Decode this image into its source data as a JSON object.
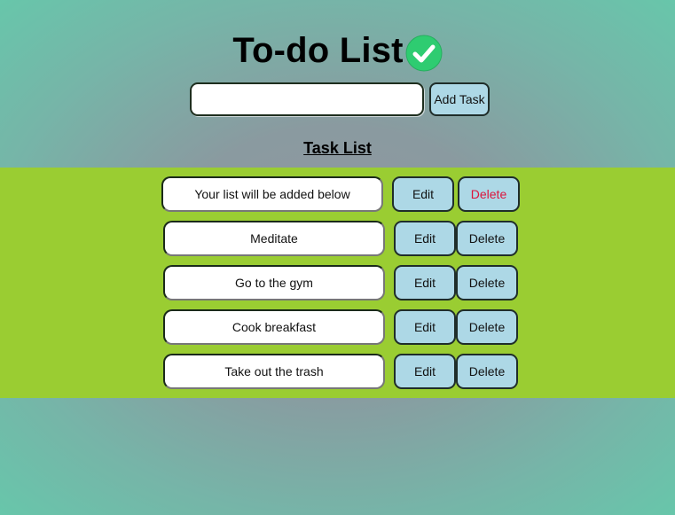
{
  "header": {
    "title": "To-do List"
  },
  "add_form": {
    "input_value": "",
    "input_placeholder": "",
    "add_label": "Add Task"
  },
  "section": {
    "title": "Task List"
  },
  "tasks": [
    {
      "text": "Your list will be added below",
      "edit_label": "Edit",
      "delete_label": "Delete"
    },
    {
      "text": "Meditate",
      "edit_label": "Edit",
      "delete_label": "Delete"
    },
    {
      "text": "Go to the gym",
      "edit_label": "Edit",
      "delete_label": "Delete"
    },
    {
      "text": "Cook breakfast",
      "edit_label": "Edit",
      "delete_label": "Delete"
    },
    {
      "text": "Take out the trash",
      "edit_label": "Edit",
      "delete_label": "Delete"
    }
  ],
  "icons": {
    "title_icon": "check-circle-icon"
  },
  "colors": {
    "task_band": "#9acd32",
    "button_bg": "#add8e6",
    "first_delete_text": "#dc143c",
    "check_icon": "#2ecc71"
  }
}
